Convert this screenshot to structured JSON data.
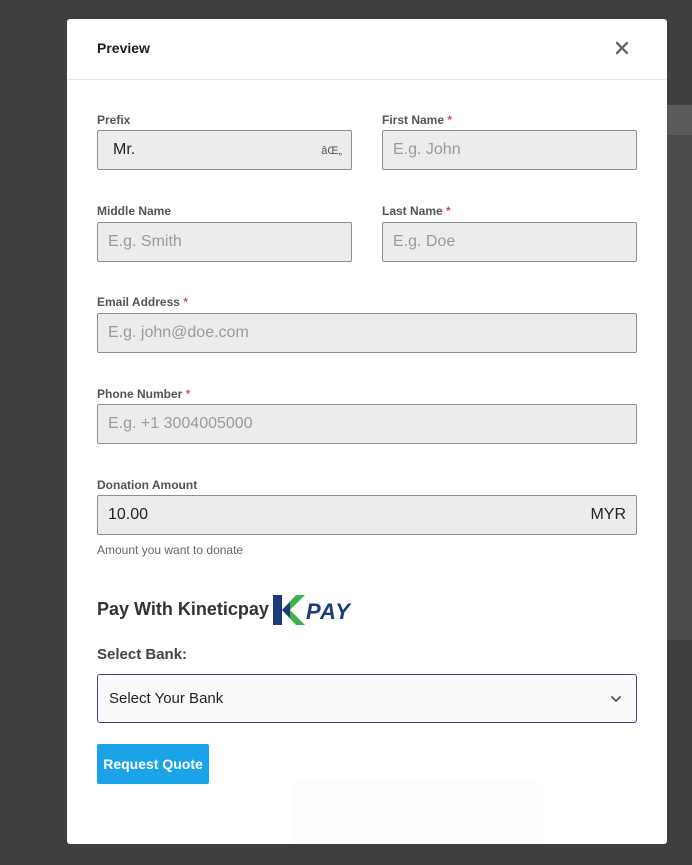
{
  "modal": {
    "title": "Preview",
    "close_icon": "close-icon"
  },
  "form": {
    "prefix": {
      "label": "Prefix",
      "value": "Mr.",
      "arrow_text": "âŒ„"
    },
    "first_name": {
      "label": "First Name",
      "required_mark": "*",
      "placeholder": "E.g. John"
    },
    "middle_name": {
      "label": "Middle Name",
      "placeholder": "E.g. Smith"
    },
    "last_name": {
      "label": "Last Name",
      "required_mark": "*",
      "placeholder": "E.g. Doe"
    },
    "email": {
      "label": "Email Address",
      "required_mark": "*",
      "placeholder": "E.g. john@doe.com"
    },
    "phone": {
      "label": "Phone Number",
      "required_mark": "*",
      "placeholder": "E.g. +1 3004005000"
    },
    "donation": {
      "label": "Donation Amount",
      "value": "10.00",
      "currency": "MYR",
      "help": "Amount you want to donate"
    }
  },
  "payment": {
    "title": "Pay With Kineticpay",
    "logo_text": "PAY",
    "logo_colors": {
      "green": "#3db24a",
      "navy": "#1d3a7a"
    },
    "select_label": "Select Bank:",
    "select_value": "Select Your Bank",
    "chevron_icon": "chevron-down-icon"
  },
  "actions": {
    "submit_label": "Request Quote",
    "submit_color": "#1aa3e8"
  }
}
